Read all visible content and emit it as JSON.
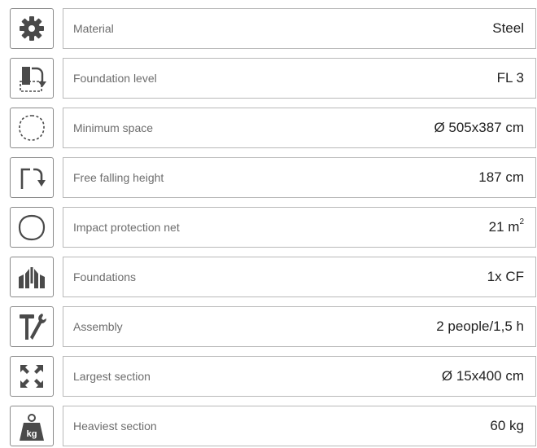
{
  "specs": [
    {
      "icon": "gear-icon",
      "label": "Material",
      "value": "Steel"
    },
    {
      "icon": "foundation-level-icon",
      "label": "Foundation level",
      "value": "FL 3"
    },
    {
      "icon": "minimum-space-icon",
      "label": "Minimum space",
      "value": "Ø 505x387 cm"
    },
    {
      "icon": "fall-height-icon",
      "label": "Free falling height",
      "value": "187 cm"
    },
    {
      "icon": "protection-net-icon",
      "label": "Impact protection net",
      "value": "21 m",
      "unit_sup": "2"
    },
    {
      "icon": "foundations-icon",
      "label": "Foundations",
      "value": "1x CF"
    },
    {
      "icon": "hammer-wrench-icon",
      "label": "Assembly",
      "value": "2 people/1,5 h"
    },
    {
      "icon": "expand-arrows-icon",
      "label": "Largest section",
      "value": "Ø 15x400 cm"
    },
    {
      "icon": "weight-kg-icon",
      "label": "Heaviest section",
      "value": "60 kg",
      "icon_text": "kg"
    }
  ],
  "colors": {
    "icon_fill": "#4a4a4a",
    "border": "#b9b9b9",
    "label": "#6d6d6d",
    "value": "#222222"
  }
}
